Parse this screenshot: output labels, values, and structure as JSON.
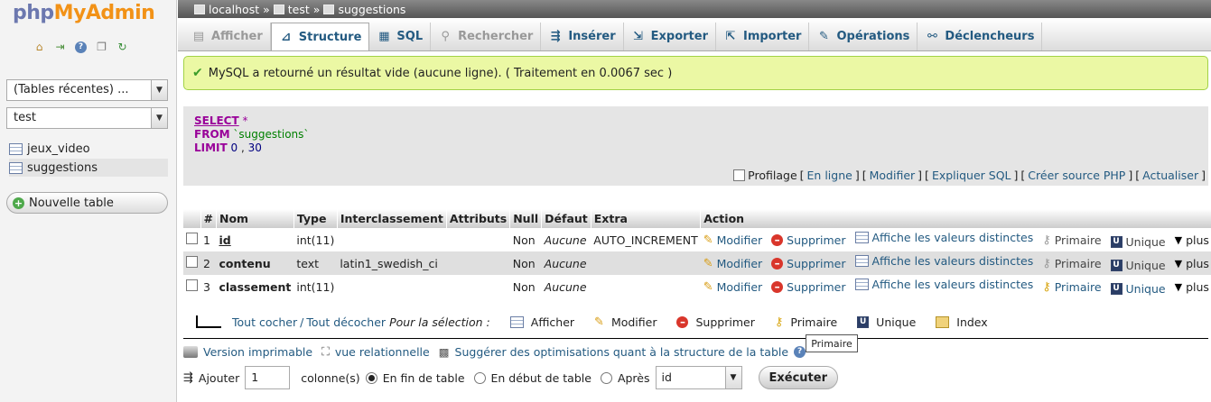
{
  "sidebar": {
    "logo_part1": "php",
    "logo_part2": "MyAdmin",
    "recent_tables": "(Tables récentes) ...",
    "database": "test",
    "tables": [
      "jeux_video",
      "suggestions"
    ],
    "new_table": "Nouvelle table"
  },
  "breadcrumb": {
    "server": "localhost",
    "database": "test",
    "table": "suggestions",
    "sep": "»"
  },
  "tabs": [
    {
      "label": "Afficher",
      "icon": "browse-icon",
      "glyph": "▤"
    },
    {
      "label": "Structure",
      "icon": "structure-icon",
      "glyph": "⊿"
    },
    {
      "label": "SQL",
      "icon": "sql-icon",
      "glyph": "▦"
    },
    {
      "label": "Rechercher",
      "icon": "search-icon",
      "glyph": "⚲"
    },
    {
      "label": "Insérer",
      "icon": "insert-icon",
      "glyph": "⇶"
    },
    {
      "label": "Exporter",
      "icon": "export-icon",
      "glyph": "⇲"
    },
    {
      "label": "Importer",
      "icon": "import-icon",
      "glyph": "⇱"
    },
    {
      "label": "Opérations",
      "icon": "wrench-icon",
      "glyph": "✎"
    },
    {
      "label": "Déclencheurs",
      "icon": "triggers-icon",
      "glyph": "⚯"
    }
  ],
  "success": "MySQL a retourné un résultat vide (aucune ligne). ( Traitement en 0.0067 sec )",
  "sql": {
    "select": "SELECT",
    "star": "*",
    "from": "FROM",
    "table": "`suggestions`",
    "limit": "LIMIT",
    "offset": "0",
    "comma": ",",
    "count": "30"
  },
  "sql_links": {
    "profiling": "Profilage",
    "inline": "En ligne",
    "edit": "Modifier",
    "explain": "Expliquer SQL",
    "php": "Créer source PHP",
    "refresh": "Actualiser"
  },
  "columns": [
    "#",
    "Nom",
    "Type",
    "Interclassement",
    "Attributs",
    "Null",
    "Défaut",
    "Extra",
    "Action"
  ],
  "rows": [
    {
      "num": "1",
      "name": "id",
      "type": "int(11)",
      "collation": "",
      "attributes": "",
      "null": "Non",
      "default": "Aucune",
      "extra": "AUTO_INCREMENT"
    },
    {
      "num": "2",
      "name": "contenu",
      "type": "text",
      "collation": "latin1_swedish_ci",
      "attributes": "",
      "null": "Non",
      "default": "Aucune",
      "extra": ""
    },
    {
      "num": "3",
      "name": "classement",
      "type": "int(11)",
      "collation": "",
      "attributes": "",
      "null": "Non",
      "default": "Aucune",
      "extra": ""
    }
  ],
  "row_actions": {
    "edit": "Modifier",
    "delete": "Supprimer",
    "distinct": "Affiche les valeurs distinctes",
    "primary": "Primaire",
    "unique": "Unique",
    "more": "plus"
  },
  "bulk": {
    "check_all": "Tout cocher",
    "slash": "/",
    "uncheck_all": "Tout décocher",
    "for_selection": "Pour la sélection :",
    "browse": "Afficher",
    "edit": "Modifier",
    "delete": "Supprimer",
    "primary": "Primaire",
    "unique": "Unique",
    "index": "Index"
  },
  "tooltip": "Primaire",
  "footer_links": {
    "print": "Version imprimable",
    "relational": "vue relationnelle",
    "suggest": "Suggérer des optimisations quant à la structure de la table"
  },
  "add": {
    "label": "Ajouter",
    "value": "1",
    "columns": "colonne(s)",
    "end": "En fin de table",
    "start": "En début de table",
    "after": "Après",
    "after_col": "id",
    "go": "Exécuter"
  }
}
